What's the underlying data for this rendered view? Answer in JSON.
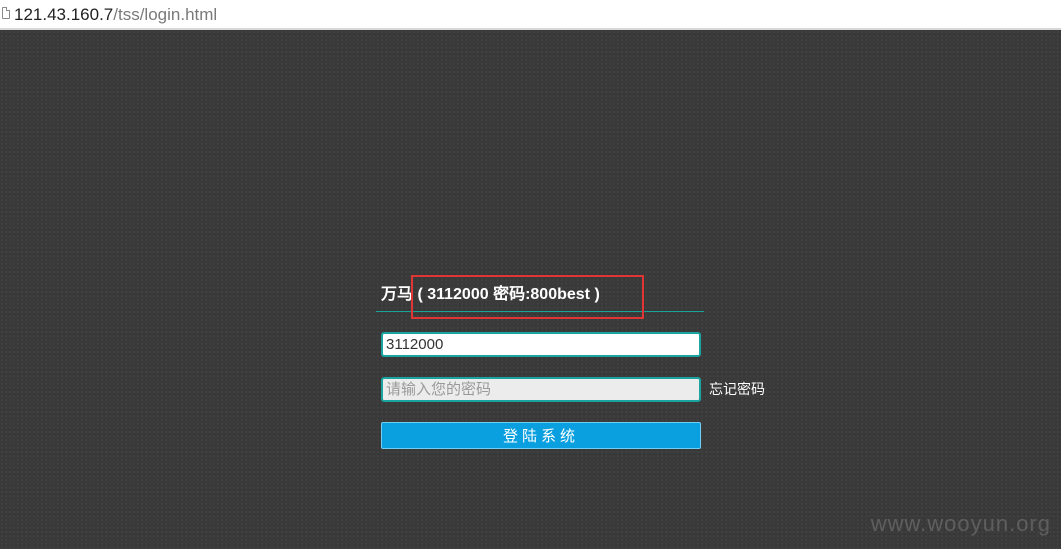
{
  "browser": {
    "url_host": "121.43.160.7",
    "url_path": "/tss/login.html"
  },
  "login": {
    "title": "万马 ( 3112000 密码:800best )",
    "username_value": "3112000",
    "password_placeholder": "请输入您的密码",
    "forgot_label": "忘记密码",
    "submit_label": "登陆系统"
  },
  "watermark": "www.wooyun.org",
  "colors": {
    "background": "#3a3a3a",
    "accent_teal": "#1aa3a0",
    "button_blue": "#0aa0df",
    "highlight_red": "#e03535"
  }
}
